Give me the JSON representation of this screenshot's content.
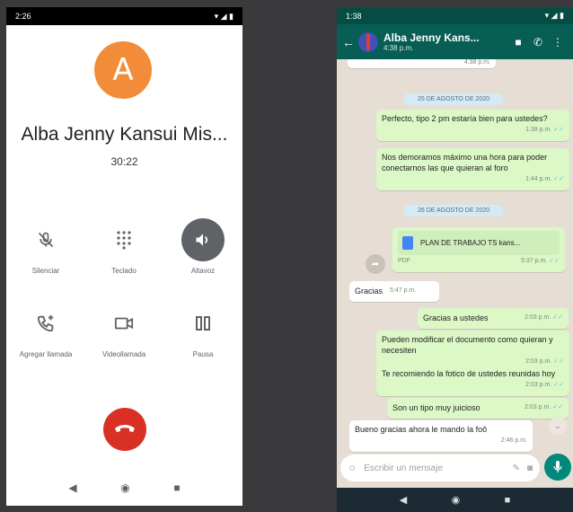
{
  "left_phone": {
    "status_time": "2:26",
    "caller_initial": "A",
    "caller_name": "Alba Jenny Kansui Mis...",
    "call_duration": "30:22",
    "buttons": {
      "mute": "Silenciar",
      "keypad": "Teclado",
      "speaker": "Altavoz",
      "add_call": "Agregar llamada",
      "video_call": "Videollamada",
      "pause": "Pausa"
    },
    "speaker_active": true
  },
  "right_phone": {
    "status_time": "1:38",
    "contact_name": "Alba Jenny Kans...",
    "contact_subtitle": "4:38 p.m.",
    "top_partial_time": "4:38 p.m.",
    "date_chip_1": "25 DE AGOSTO DE 2020",
    "date_chip_2": "26 DE AGOSTO DE 2020",
    "messages": [
      {
        "text": "Perfecto, tipo 2 pm estaría bien para ustedes?",
        "time": "1:38 p.m."
      },
      {
        "text": "Nos demoramos máximo una hora para poder conectarnos las que quieran al foro",
        "time": "1:44 p.m."
      },
      {
        "text": "PLAN DE TRABAJO TS kans...",
        "subtext": "PDF",
        "time": "5:37 p.m."
      },
      {
        "text": "Gracias",
        "time": "5:47 p.m."
      },
      {
        "text": "Gracias a ustedes",
        "time": "2:03 p.m."
      },
      {
        "text": "Pueden modificar el documento como quieran y necesiten",
        "time": "2:03 p.m."
      },
      {
        "text": "Te recomiendo la fotico de ustedes reunidas hoy",
        "time": "2:03 p.m."
      },
      {
        "text": "Son un tipo muy juicioso",
        "time": "2:03 p.m."
      },
      {
        "text": "Bueno gracias ahora le mando la foô",
        "time": "2:46 p.m."
      }
    ],
    "input_placeholder": "Escribir un mensaje"
  },
  "colors": {
    "avatar": "#f28c38",
    "hangup": "#d93025",
    "whatsapp_header": "#075e54",
    "outgoing_bubble": "#dcf8c6"
  }
}
